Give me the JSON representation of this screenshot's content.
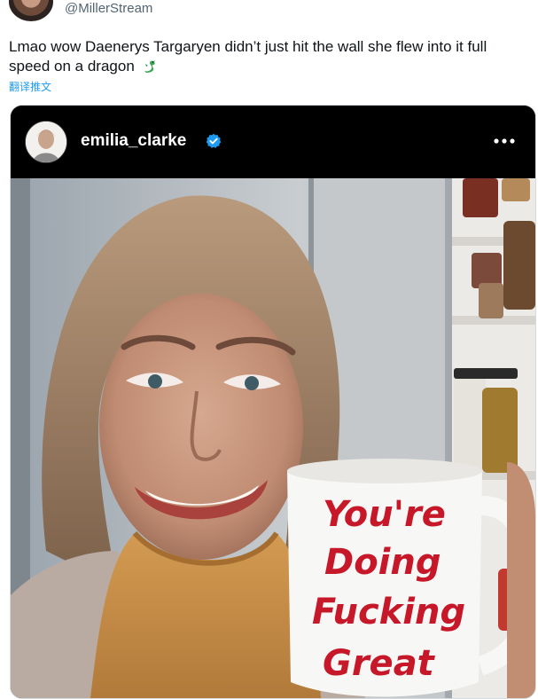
{
  "tweet": {
    "handle": "@MillerStream",
    "text": "Lmao wow Daenerys Targaryen didn’t just hit the wall she flew into it full speed on a dragon",
    "translate_label": "翻译推文"
  },
  "instagram": {
    "username": "emilia_clarke"
  },
  "mug": {
    "lines": [
      "You're",
      "Doing",
      "Fucking",
      "Great"
    ]
  },
  "icons": {
    "dragon": "dragon-emoji",
    "verified": "verified-badge-icon",
    "more": "more-options-icon"
  },
  "colors": {
    "verified_blue": "#1d9bf0",
    "mug_text_red": "#c7182a",
    "sweater_orange": "#c98f4a"
  }
}
